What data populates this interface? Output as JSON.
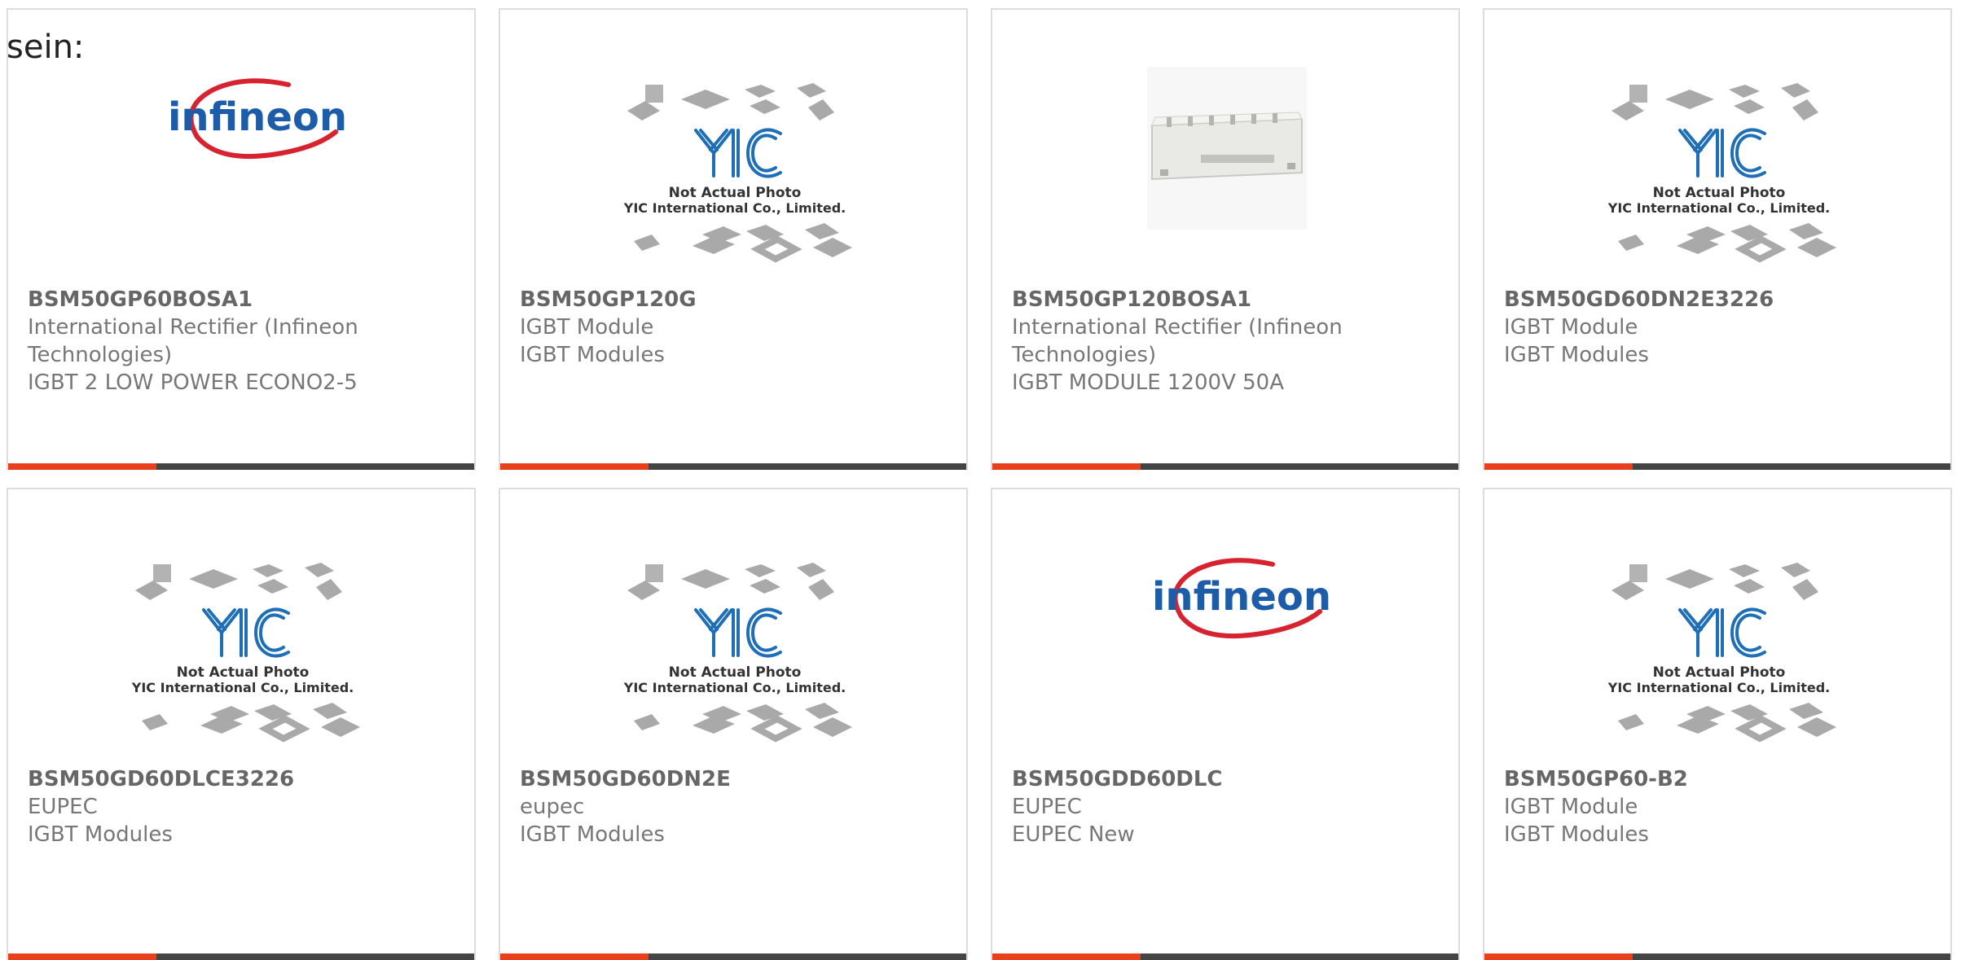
{
  "intro_text": "sein:",
  "colors": {
    "accent": "#e8401c",
    "bar": "#444444",
    "border": "#dcdcdc",
    "text": "#777777"
  },
  "cards": [
    {
      "part_number": "BSM50GP60BOSA1",
      "line1": "International Rectifier (Infineon",
      "line2": "Technologies)",
      "line3": "IGBT 2 LOW POWER ECONO2-5",
      "image": "infineon-logo",
      "logo_text": "infineon"
    },
    {
      "part_number": "BSM50GP120G",
      "line1": "IGBT Module",
      "line2": "IGBT Modules",
      "line3": "",
      "image": "yic-placeholder",
      "placeholder_line1": "Not Actual Photo",
      "placeholder_line2": "YIC International Co., Limited."
    },
    {
      "part_number": "BSM50GP120BOSA1",
      "line1": "International Rectifier (Infineon",
      "line2": "Technologies)",
      "line3": "IGBT MODULE 1200V 50A",
      "image": "igbt-module-photo"
    },
    {
      "part_number": "BSM50GD60DN2E3226",
      "line1": "IGBT Module",
      "line2": "IGBT Modules",
      "line3": "",
      "image": "yic-placeholder",
      "placeholder_line1": "Not Actual Photo",
      "placeholder_line2": "YIC International Co., Limited."
    },
    {
      "part_number": "BSM50GD60DLCE3226",
      "line1": "EUPEC",
      "line2": "IGBT Modules",
      "line3": "",
      "image": "yic-placeholder",
      "placeholder_line1": "Not Actual Photo",
      "placeholder_line2": "YIC International Co., Limited."
    },
    {
      "part_number": "BSM50GD60DN2E",
      "line1": "eupec",
      "line2": "IGBT Modules",
      "line3": "",
      "image": "yic-placeholder",
      "placeholder_line1": "Not Actual Photo",
      "placeholder_line2": "YIC International Co., Limited."
    },
    {
      "part_number": "BSM50GDD60DLC",
      "line1": "EUPEC",
      "line2": "EUPEC New",
      "line3": "",
      "image": "infineon-logo",
      "logo_text": "infineon"
    },
    {
      "part_number": "BSM50GP60-B2",
      "line1": "IGBT Module",
      "line2": "IGBT Modules",
      "line3": "",
      "image": "yic-placeholder",
      "placeholder_line1": "Not Actual Photo",
      "placeholder_line2": "YIC International Co., Limited."
    }
  ]
}
